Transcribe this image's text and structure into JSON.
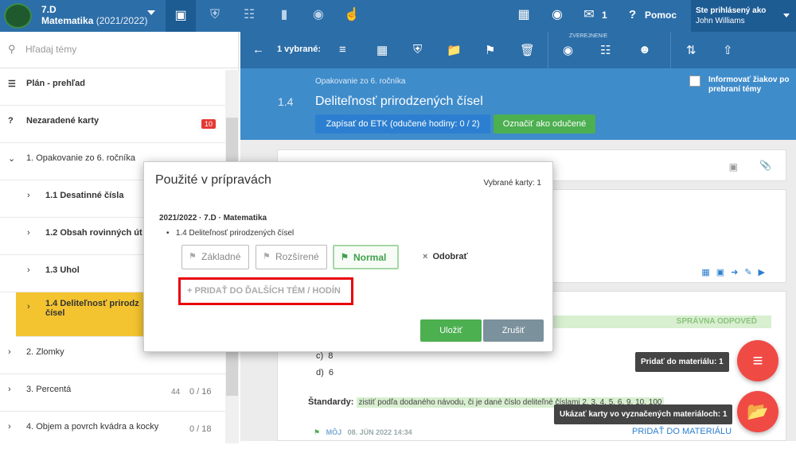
{
  "topbar": {
    "class_name": "7.D",
    "subject": "Matematika",
    "year": "(2021/2022)",
    "messages_count": "1",
    "help_label": "Pomoc",
    "user_label": "Ste prihlásený ako",
    "user_name": "John Williams"
  },
  "sidebar": {
    "search_placeholder": "Hľadaj témy",
    "plan_label": "Plán - prehľad",
    "unassigned_label": "Nezaradené karty",
    "unassigned_count": "10",
    "items": [
      {
        "label": "1. Opakovanie zo 6. ročníka"
      },
      {
        "label": "1.1 Desatinné čísla"
      },
      {
        "label": "1.2 Obsah rovinných út"
      },
      {
        "label": "1.3 Uhol"
      },
      {
        "label": "1.4 Deliteľnosť prirodz",
        "label2": "čísel"
      },
      {
        "label": "2. Zlomky"
      },
      {
        "label": "3. Percentá",
        "count": "44",
        "ratio": "0 / 16"
      },
      {
        "label": "4. Objem a povrch kvádra a kocky",
        "ratio": "0 / 18"
      }
    ]
  },
  "toolbar": {
    "selected_label": "1 vybrané:",
    "published_label": "ZVEREJNENIE"
  },
  "header": {
    "subtitle": "Opakovanie zo 6. ročníka",
    "number": "1.4",
    "title": "Deliteľnosť prirodzených čísel",
    "etk_button": "Zapísať do ETK (odučené hodiny: 0 / 2)",
    "taught_button": "Označiť ako odučené",
    "inform_label": "Informovať žiakov po prebraní témy"
  },
  "content": {
    "correct_answer": "SPRÁVNA ODPOVEĎ",
    "opt_c_label": "c)",
    "opt_c": "8",
    "opt_d_label": "d)",
    "opt_d": "6",
    "standards_label": "Štandardy:",
    "standards_text": "zistiť podľa dodaného návodu, či je dané číslo deliteľné číslami 2, 3, 4, 5, 6, 9, 10, 100",
    "footer_author": "MÔJ",
    "footer_date": "08. JÚN 2022 14:34",
    "add_to_material": "PRIDAŤ DO MATERIÁLU"
  },
  "modal": {
    "title": "Použité v prípravách",
    "selected_cards": "Vybrané karty: 1",
    "crumb": "2021/2022 · 7.D · Matematika",
    "item": "1.4 Deliteľnosť prirodzených čísel",
    "level_basic": "Základné",
    "level_extended": "Rozšírené",
    "level_normal": "Normal",
    "remove": "Odobrať",
    "add_more": "PRIDAŤ DO ĎALŠÍCH TÉM / HODÍN",
    "save": "Uložiť",
    "cancel": "Zrušiť"
  },
  "fab": {
    "add_tooltip": "Pridať do materiálu: 1",
    "show_tooltip": "Ukázať karty vo vyznačených materiáloch: 1"
  },
  "colors": {
    "primary": "#2c6ea8",
    "header": "#3f8ccb",
    "highlight": "#f4c430",
    "success": "#4caf50",
    "danger": "#f04a45"
  }
}
